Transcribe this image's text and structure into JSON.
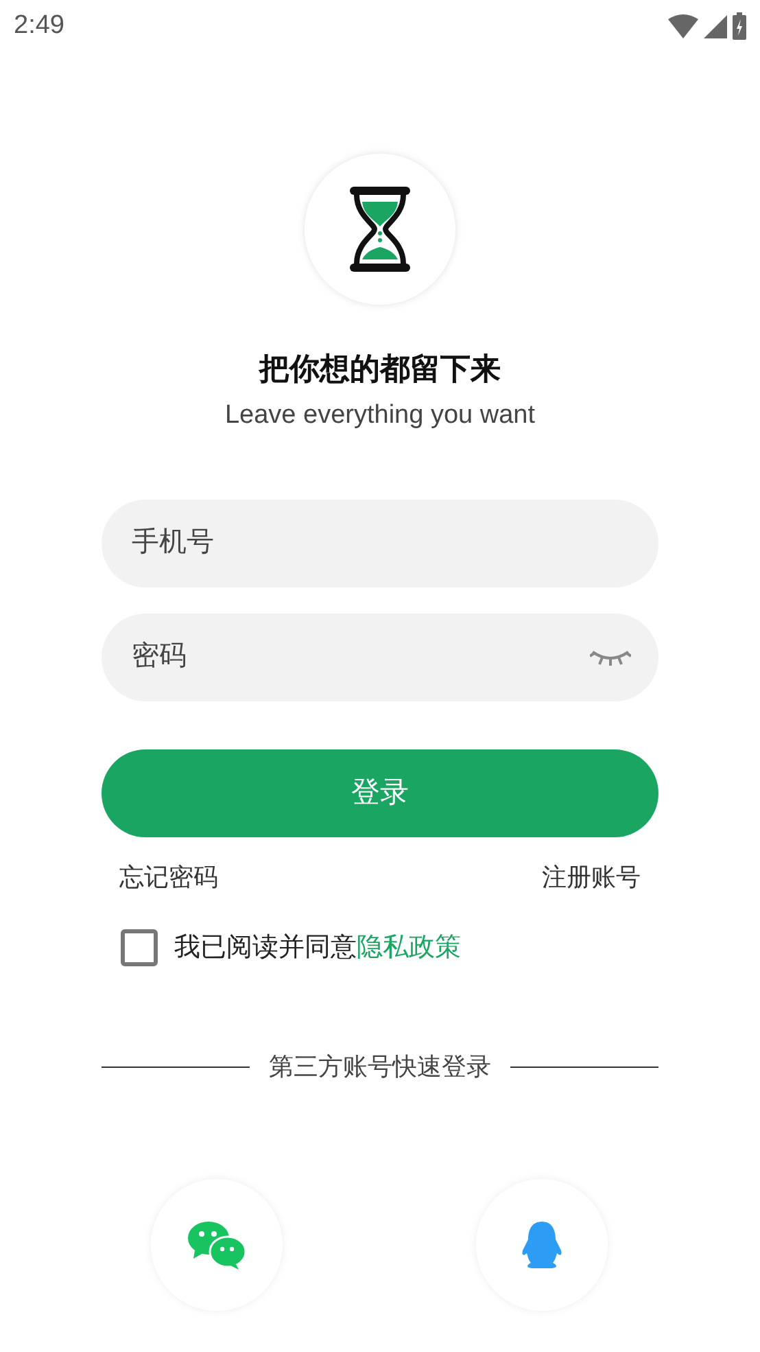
{
  "status_bar": {
    "time": "2:49"
  },
  "header": {
    "title": "把你想的都留下来",
    "subtitle": "Leave everything you want"
  },
  "phone_field": {
    "placeholder": "手机号"
  },
  "password_field": {
    "placeholder": "密码",
    "visible": false
  },
  "login_button": "登录",
  "links": {
    "forgot": "忘记密码",
    "register": "注册账号"
  },
  "agreement": {
    "checked": false,
    "text": "我已阅读并同意",
    "link": "隐私政策"
  },
  "third_party": {
    "label": "第三方账号快速登录"
  }
}
